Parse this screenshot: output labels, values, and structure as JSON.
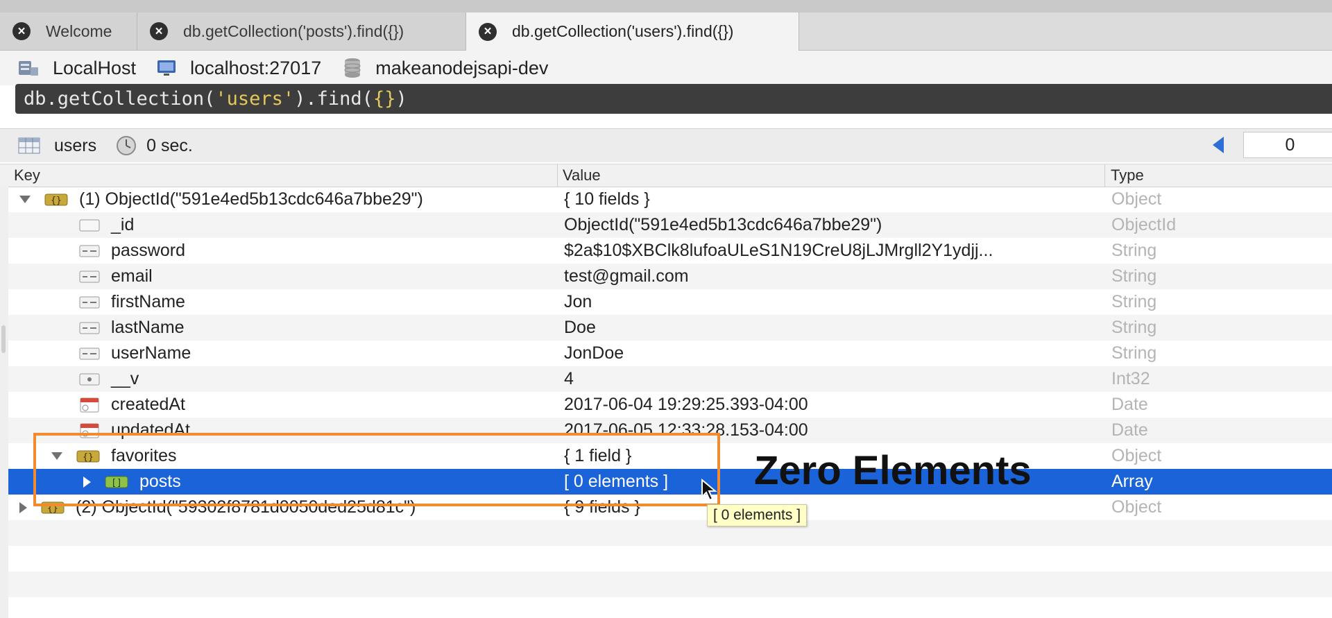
{
  "tabs": [
    {
      "label": "Welcome"
    },
    {
      "label": "db.getCollection('posts').find({})"
    },
    {
      "label": "db.getCollection('users').find({})"
    }
  ],
  "connection": {
    "server": "LocalHost",
    "host": "localhost:27017",
    "database": "makeanodejsapi-dev"
  },
  "query": {
    "prefix": "db.getCollection(",
    "string": "'users'",
    "mid": ").find(",
    "args": "{}",
    "suffix": ")"
  },
  "result": {
    "collection": "users",
    "time": "0 sec.",
    "page": "0"
  },
  "columns": {
    "key": "Key",
    "value": "Value",
    "type": "Type"
  },
  "rows": [
    {
      "key": "(1) ObjectId(\"591e4ed5b13cdc646a7bbe29\")",
      "value": "{ 10 fields }",
      "type": "Object"
    },
    {
      "key": "_id",
      "value": "ObjectId(\"591e4ed5b13cdc646a7bbe29\")",
      "type": "ObjectId"
    },
    {
      "key": "password",
      "value": "$2a$10$XBClk8lufoaULeS1N19CreU8jLJMrgll2Y1ydjj...",
      "type": "String"
    },
    {
      "key": "email",
      "value": "test@gmail.com",
      "type": "String"
    },
    {
      "key": "firstName",
      "value": "Jon",
      "type": "String"
    },
    {
      "key": "lastName",
      "value": "Doe",
      "type": "String"
    },
    {
      "key": "userName",
      "value": "JonDoe",
      "type": "String"
    },
    {
      "key": "__v",
      "value": "4",
      "type": "Int32"
    },
    {
      "key": "createdAt",
      "value": "2017-06-04 19:29:25.393-04:00",
      "type": "Date"
    },
    {
      "key": "updatedAt",
      "value": "2017-06-05 12:33:28.153-04:00",
      "type": "Date"
    },
    {
      "key": "favorites",
      "value": "{ 1 field }",
      "type": "Object"
    },
    {
      "key": "posts",
      "value": "[ 0 elements ]",
      "type": "Array"
    },
    {
      "key": "(2) ObjectId(\"59302f8781d0050ded25d81c\")",
      "value": "{ 9 fields }",
      "type": "Object"
    }
  ],
  "tooltip": "[ 0 elements ]",
  "annotation": "Zero Elements",
  "colors": {
    "selection": "#1a63d8",
    "highlight_box": "#f28b2f",
    "tooltip_bg": "#ffffc6"
  }
}
